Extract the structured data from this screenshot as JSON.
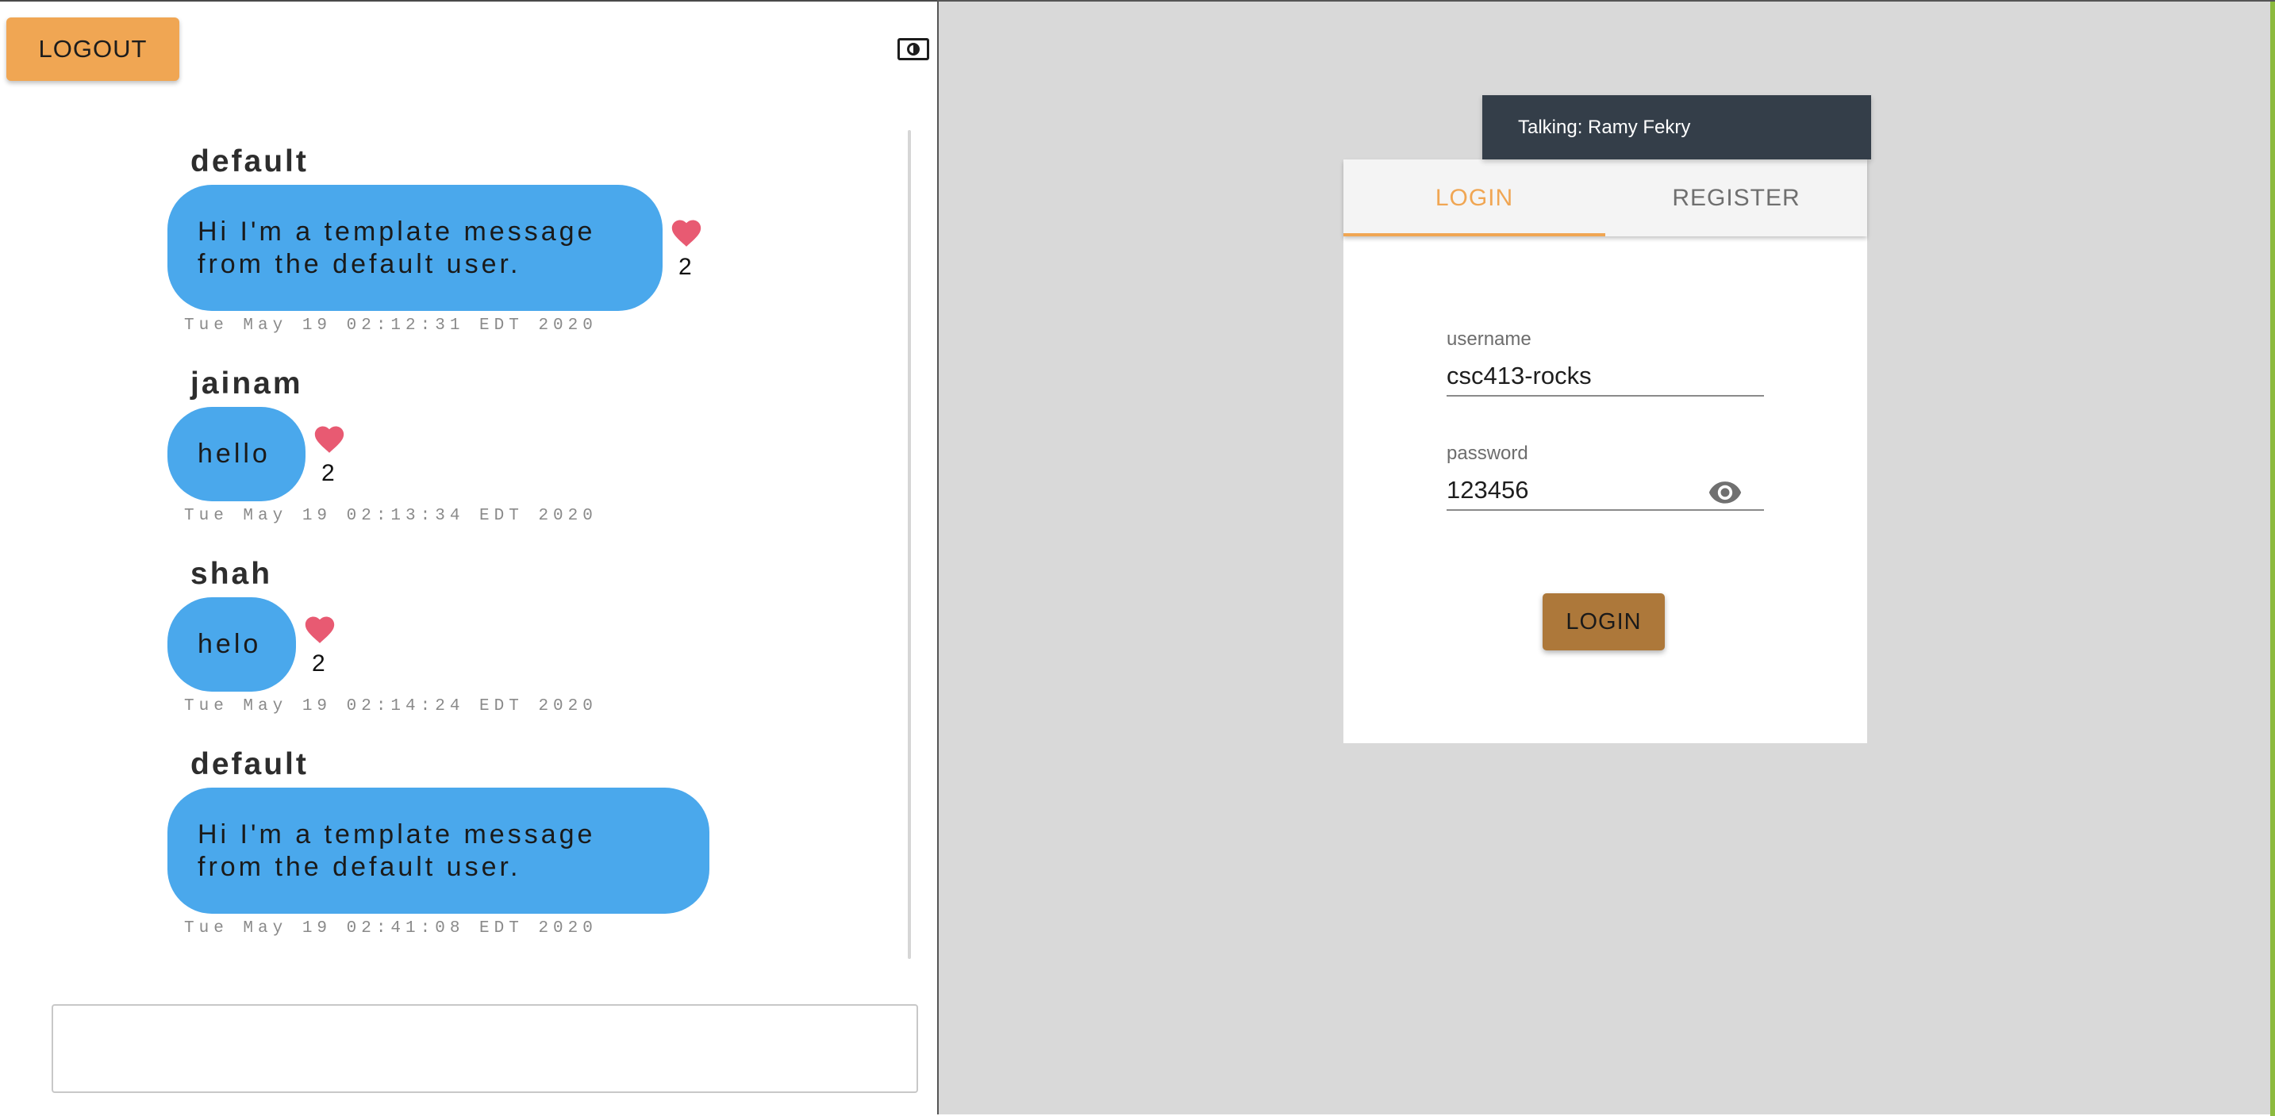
{
  "header": {
    "logout_label": "LOGOUT"
  },
  "chat": {
    "messages": [
      {
        "author": "default",
        "text": "Hi I'm a template message\nfrom the default user.",
        "likes": "2",
        "timestamp": "Tue May 19 02:12:31 EDT 2020"
      },
      {
        "author": "jainam",
        "text": "hello",
        "likes": "2",
        "timestamp": "Tue May 19 02:13:34 EDT 2020"
      },
      {
        "author": "shah",
        "text": "helo",
        "likes": "2",
        "timestamp": "Tue May 19 02:14:24 EDT 2020"
      },
      {
        "author": "default",
        "text": "Hi I'm a template message\nfrom the default user.",
        "likes": "",
        "timestamp": "Tue May 19 02:41:08 EDT 2020"
      }
    ],
    "input_value": ""
  },
  "login": {
    "talking_banner": "Talking: Ramy Fekry",
    "tabs": [
      {
        "label": "LOGIN",
        "active": true
      },
      {
        "label": "REGISTER",
        "active": false
      }
    ],
    "username_label": "username",
    "username_value": "csc413-rocks",
    "password_label": "password",
    "password_value": "123456",
    "submit_label": "LOGIN"
  },
  "colors": {
    "bubble": "#4aa8ec",
    "heart": "#e85a72",
    "logout_button": "#f0a653",
    "active_tab": "#f0a653",
    "login_button": "#ad783a",
    "banner": "#343e49",
    "right_background": "#d9d9d9",
    "accent_bar": "#8cba3e"
  },
  "icons": {
    "theme_toggle": "theme-toggle-icon",
    "like": "heart-icon",
    "password_visibility": "eye-icon"
  }
}
